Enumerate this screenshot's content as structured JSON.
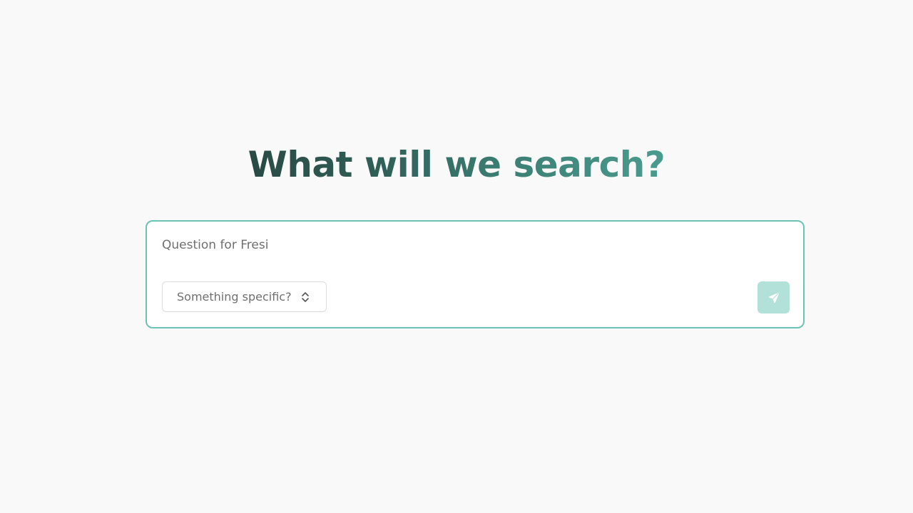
{
  "heading": {
    "text": "What will we search?"
  },
  "search": {
    "placeholder": "Question for Fresi",
    "value": ""
  },
  "filter": {
    "label": "Something specific?",
    "icon": "chevron-up-down-icon"
  },
  "send": {
    "icon": "send-icon"
  },
  "colors": {
    "background": "#f9f9f9",
    "accent_border": "#6cc2b5",
    "send_button": "#b1e1d8",
    "heading_start": "#2a4a44",
    "heading_end": "#4a9c8f"
  }
}
